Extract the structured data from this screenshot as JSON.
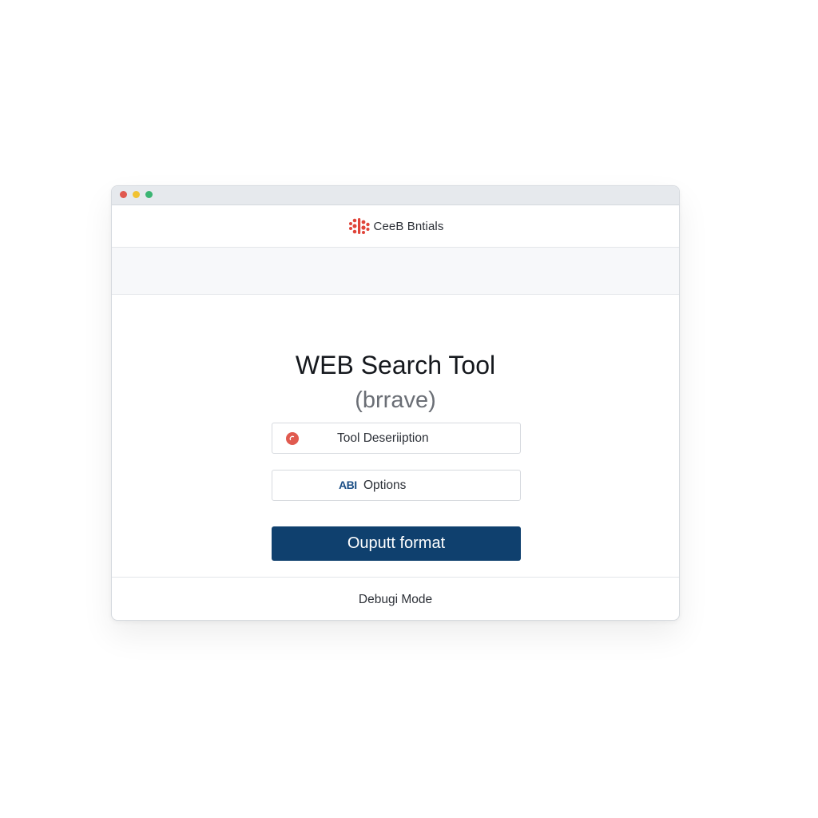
{
  "window": {
    "controls": {
      "close_color": "#e0594f",
      "minimize_color": "#f1c232",
      "zoom_color": "#3bb573"
    }
  },
  "header": {
    "brand_name": "CeeB Bntials",
    "logo_icon": "brand-logo-icon",
    "logo_color": "#e0453a"
  },
  "main": {
    "title": "WEB Search Tool",
    "subtitle": "(brrave)",
    "description_field": {
      "label": "Tool Deseriiption",
      "icon": "red-circle-icon",
      "icon_color": "#e05a4f"
    },
    "options_field": {
      "icon_text": "ABI",
      "label": "Options"
    },
    "primary_button": {
      "label": "Ouputt format",
      "color": "#0f406e"
    }
  },
  "footer": {
    "label": "Debugi  Mode"
  }
}
